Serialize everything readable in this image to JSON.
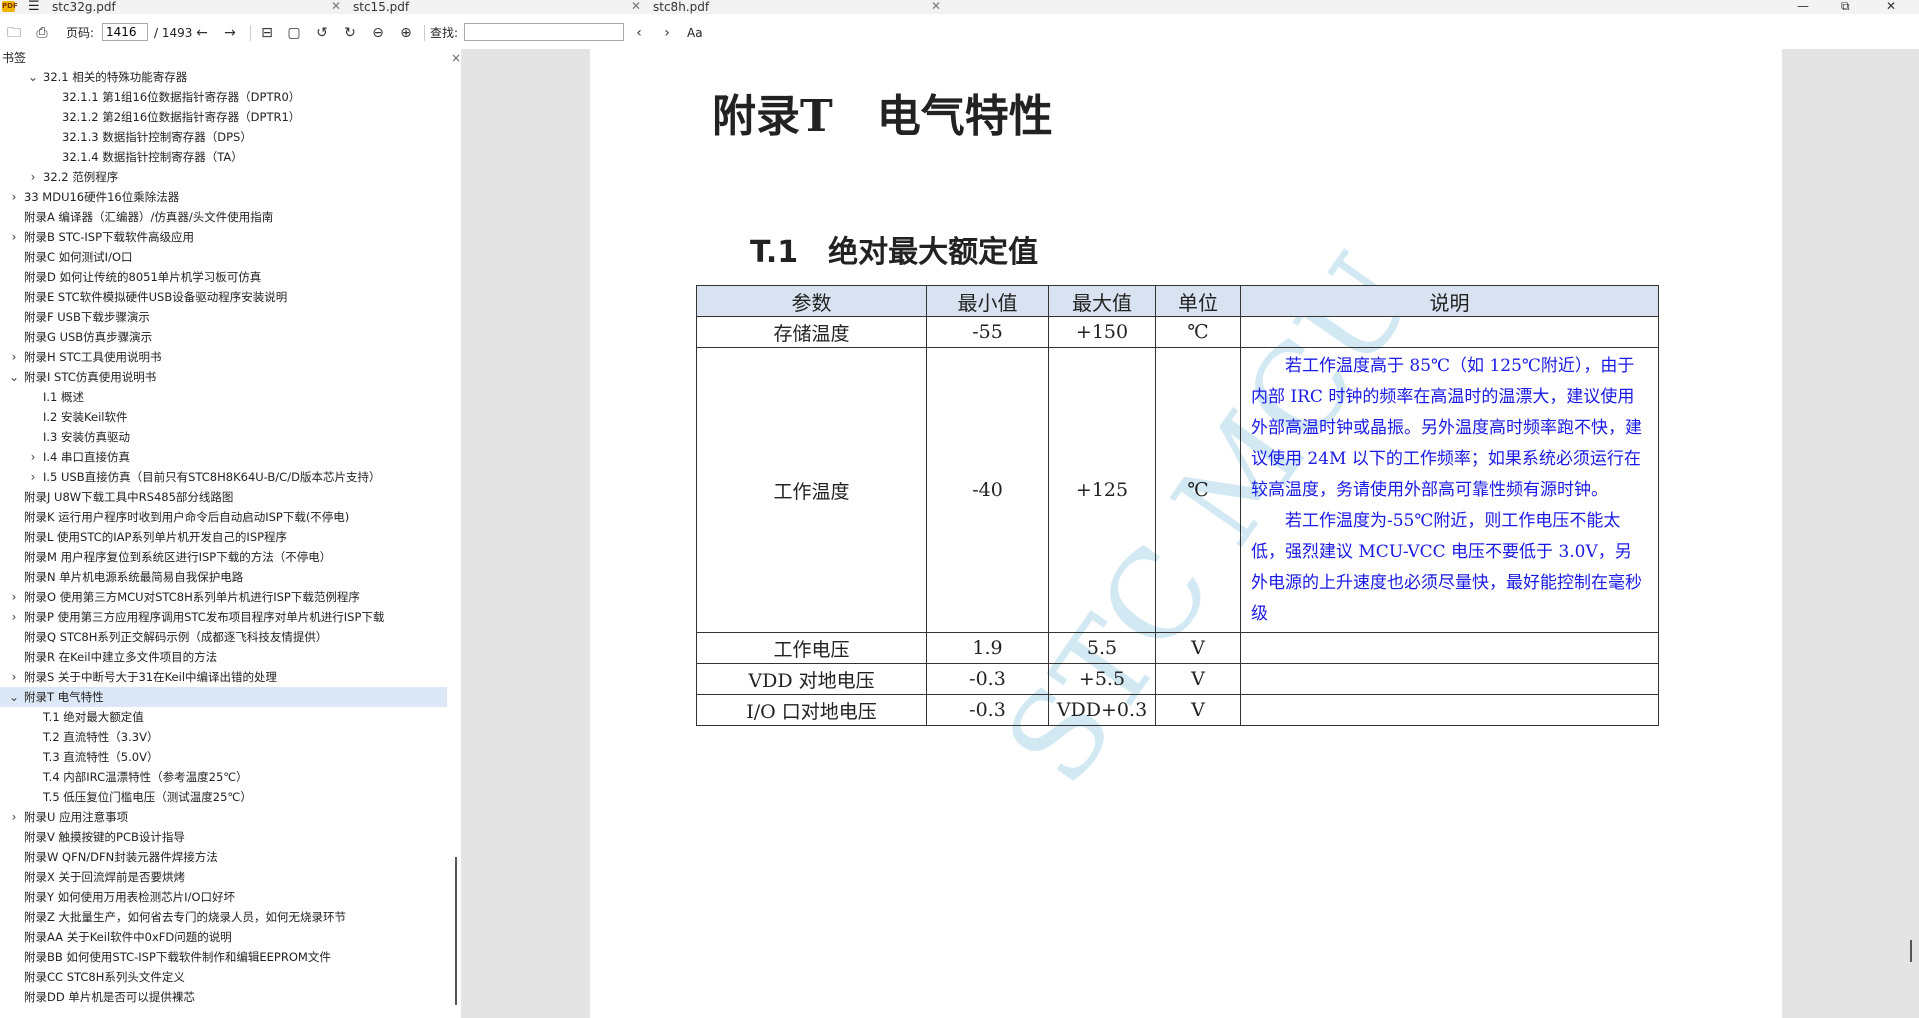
{
  "tabs": [
    {
      "label": "stc32g.pdf"
    },
    {
      "label": "stc15.pdf"
    },
    {
      "label": "stc8h.pdf"
    }
  ],
  "window": {
    "minimize": "—",
    "maximize": "⧉",
    "close": "✕"
  },
  "toolbar": {
    "page_label": "页码:",
    "current_page": "1416",
    "total_pages": "/ 1493",
    "search_label": "查找:",
    "search_value": "",
    "match_case": "Aa"
  },
  "sidebar": {
    "title": "书签",
    "close": "×",
    "items": [
      {
        "label": "32.1 相关的特殊功能寄存器",
        "level": 2,
        "arrow": "⌄"
      },
      {
        "label": "32.1.1 第1组16位数据指针寄存器（DPTR0）",
        "level": 3,
        "arrow": ""
      },
      {
        "label": "32.1.2 第2组16位数据指针寄存器（DPTR1）",
        "level": 3,
        "arrow": ""
      },
      {
        "label": "32.1.3 数据指针控制寄存器（DPS）",
        "level": 3,
        "arrow": ""
      },
      {
        "label": "32.1.4 数据指针控制寄存器（TA）",
        "level": 3,
        "arrow": ""
      },
      {
        "label": "32.2 范例程序",
        "level": 2,
        "arrow": "›"
      },
      {
        "label": "33 MDU16硬件16位乘除法器",
        "level": 1,
        "arrow": "›"
      },
      {
        "label": "附录A 编译器（汇编器）/仿真器/头文件使用指南",
        "level": 1,
        "arrow": ""
      },
      {
        "label": "附录B STC-ISP下载软件高级应用",
        "level": 1,
        "arrow": "›"
      },
      {
        "label": "附录C 如何测试I/O口",
        "level": 1,
        "arrow": ""
      },
      {
        "label": "附录D 如何让传统的8051单片机学习板可仿真",
        "level": 1,
        "arrow": ""
      },
      {
        "label": "附录E STC软件模拟硬件USB设备驱动程序安装说明",
        "level": 1,
        "arrow": ""
      },
      {
        "label": "附录F USB下载步骤演示",
        "level": 1,
        "arrow": ""
      },
      {
        "label": "附录G USB仿真步骤演示",
        "level": 1,
        "arrow": ""
      },
      {
        "label": "附录H STC工具使用说明书",
        "level": 1,
        "arrow": "›"
      },
      {
        "label": "附录I STC仿真使用说明书",
        "level": 1,
        "arrow": "⌄"
      },
      {
        "label": "I.1 概述",
        "level": 2,
        "arrow": ""
      },
      {
        "label": "I.2 安装Keil软件",
        "level": 2,
        "arrow": ""
      },
      {
        "label": "I.3 安装仿真驱动",
        "level": 2,
        "arrow": ""
      },
      {
        "label": "I.4 串口直接仿真",
        "level": 2,
        "arrow": "›"
      },
      {
        "label": "I.5 USB直接仿真（目前只有STC8H8K64U-B/C/D版本芯片支持）",
        "level": 2,
        "arrow": "›"
      },
      {
        "label": "附录J U8W下载工具中RS485部分线路图",
        "level": 1,
        "arrow": ""
      },
      {
        "label": "附录K 运行用户程序时收到用户命令后自动启动ISP下载(不停电)",
        "level": 1,
        "arrow": ""
      },
      {
        "label": "附录L 使用STC的IAP系列单片机开发自己的ISP程序",
        "level": 1,
        "arrow": ""
      },
      {
        "label": "附录M 用户程序复位到系统区进行ISP下载的方法（不停电）",
        "level": 1,
        "arrow": ""
      },
      {
        "label": "附录N 单片机电源系统最简易自我保护电路",
        "level": 1,
        "arrow": ""
      },
      {
        "label": "附录O 使用第三方MCU对STC8H系列单片机进行ISP下载范例程序",
        "level": 1,
        "arrow": "›"
      },
      {
        "label": "附录P 使用第三方应用程序调用STC发布项目程序对单片机进行ISP下载",
        "level": 1,
        "arrow": "›"
      },
      {
        "label": "附录Q STC8H系列正交解码示例（成都逐飞科技友情提供）",
        "level": 1,
        "arrow": ""
      },
      {
        "label": "附录R 在Keil中建立多文件项目的方法",
        "level": 1,
        "arrow": ""
      },
      {
        "label": "附录S 关于中断号大于31在Keil中编译出错的处理",
        "level": 1,
        "arrow": "›"
      },
      {
        "label": "附录T 电气特性",
        "level": 1,
        "arrow": "⌄",
        "selected": true
      },
      {
        "label": "T.1 绝对最大额定值",
        "level": 2,
        "arrow": ""
      },
      {
        "label": "T.2 直流特性（3.3V）",
        "level": 2,
        "arrow": ""
      },
      {
        "label": "T.3 直流特性（5.0V）",
        "level": 2,
        "arrow": ""
      },
      {
        "label": "T.4 内部IRC温漂特性（参考温度25℃）",
        "level": 2,
        "arrow": ""
      },
      {
        "label": "T.5 低压复位门槛电压（测试温度25℃）",
        "level": 2,
        "arrow": ""
      },
      {
        "label": "附录U 应用注意事项",
        "level": 1,
        "arrow": "›"
      },
      {
        "label": "附录V 触摸按键的PCB设计指导",
        "level": 1,
        "arrow": ""
      },
      {
        "label": "附录W QFN/DFN封装元器件焊接方法",
        "level": 1,
        "arrow": ""
      },
      {
        "label": "附录X 关于回流焊前是否要烘烤",
        "level": 1,
        "arrow": ""
      },
      {
        "label": "附录Y 如何使用万用表检测芯片I/O口好坏",
        "level": 1,
        "arrow": ""
      },
      {
        "label": "附录Z 大批量生产，如何省去专门的烧录人员，如何无烧录环节",
        "level": 1,
        "arrow": ""
      },
      {
        "label": "附录AA 关于Keil软件中0xFD问题的说明",
        "level": 1,
        "arrow": ""
      },
      {
        "label": "附录BB 如何使用STC-ISP下载软件制作和编辑EEPROM文件",
        "level": 1,
        "arrow": ""
      },
      {
        "label": "附录CC STC8H系列头文件定义",
        "level": 1,
        "arrow": ""
      },
      {
        "label": "附录DD 单片机是否可以提供裸芯",
        "level": 1,
        "arrow": ""
      }
    ]
  },
  "document": {
    "appendix_title": "附录T　电气特性",
    "section_title": "T.1　绝对最大额定值",
    "table": {
      "headers": [
        "参数",
        "最小值",
        "最大值",
        "单位",
        "说明"
      ],
      "rows": [
        {
          "param": "存储温度",
          "min": "-55",
          "max": "+150",
          "unit": "℃",
          "desc": []
        },
        {
          "param": "工作温度",
          "min": "-40",
          "max": "+125",
          "unit": "℃",
          "desc": [
            "若工作温度高于 85℃（如 125℃附近），由于内部 IRC 时钟的频率在高温时的温漂大，建议使用外部高温时钟或晶振。另外温度高时频率跑不快，建议使用 24M 以下的工作频率；如果系统必须运行在较高温度，务请使用外部高可靠性频有源时钟。",
            "若工作温度为-55℃附近，则工作电压不能太低，强烈建议 MCU-VCC 电压不要低于 3.0V，另外电源的上升速度也必须尽量快，最好能控制在毫秒级"
          ]
        },
        {
          "param": "工作电压",
          "min": "1.9",
          "max": "5.5",
          "unit": "V",
          "desc": []
        },
        {
          "param": "VDD 对地电压",
          "min": "-0.3",
          "max": "+5.5",
          "unit": "V",
          "desc": []
        },
        {
          "param": "I/O 口对地电压",
          "min": "-0.3",
          "max": "VDD+0.3",
          "unit": "V",
          "desc": []
        }
      ]
    },
    "watermark": "STC MCU"
  },
  "colors": {
    "selected_bg": "#dde8f6",
    "table_header_bg": "#d9e2f0",
    "desc_text": "#1a1ae6",
    "watermark": "#d2e9f3"
  }
}
